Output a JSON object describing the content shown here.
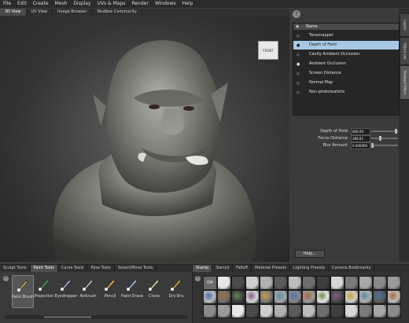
{
  "menu": [
    "File",
    "Edit",
    "Create",
    "Mesh",
    "Display",
    "UVs & Maps",
    "Render",
    "Windows",
    "Help"
  ],
  "view_tabs": [
    {
      "label": "3D View",
      "active": true
    },
    {
      "label": "UV View",
      "active": false
    },
    {
      "label": "Image Browser",
      "active": false
    },
    {
      "label": "Mudbox Community",
      "active": false
    }
  ],
  "viewcube": {
    "label": "FRONT"
  },
  "right_panel": {
    "help_icon": "?",
    "side_tabs": [
      "Layers",
      "Object List",
      "Viewport Filters"
    ],
    "filters_header": {
      "name_label": "Name"
    },
    "filters": [
      {
        "label": "Tonemapper",
        "selected": false,
        "enabled": false
      },
      {
        "label": "Depth of Field",
        "selected": true,
        "enabled": true
      },
      {
        "label": "Cavity Ambient Occlusion",
        "selected": false,
        "enabled": false
      },
      {
        "label": "Ambient Occlusion",
        "selected": false,
        "enabled": true
      },
      {
        "label": "Screen Distance",
        "selected": false,
        "enabled": false
      },
      {
        "label": "Normal Map",
        "selected": false,
        "enabled": false
      },
      {
        "label": "Non-photorealistic",
        "selected": false,
        "enabled": false
      }
    ],
    "properties": [
      {
        "label": "Depth of Field",
        "value": "600.00",
        "level": 0.95
      },
      {
        "label": "Focus Distance",
        "value": "368.81",
        "level": 0.3
      },
      {
        "label": "Blur Amount",
        "value": "0.000000",
        "level": 0.0
      }
    ],
    "help_button": "Help..."
  },
  "tool_tabs": [
    {
      "label": "Sculpt Tools",
      "active": false
    },
    {
      "label": "Paint Tools",
      "active": true
    },
    {
      "label": "Curve Tools",
      "active": false
    },
    {
      "label": "Pose Tools",
      "active": false
    },
    {
      "label": "Select/Move Tools",
      "active": false
    }
  ],
  "tools_help_icon": "?",
  "paint_tools": [
    {
      "label": "Paint Brush",
      "icon": "paint-brush-icon",
      "active": true,
      "color": "#c9a25a"
    },
    {
      "label": "Projection",
      "icon": "projection-icon",
      "active": false,
      "color": "#4f9a4f"
    },
    {
      "label": "Eyedropper",
      "icon": "eyedropper-icon",
      "active": false,
      "color": "#9aa8b8"
    },
    {
      "label": "Airbrush",
      "icon": "airbrush-icon",
      "active": false,
      "color": "#b0b0b0"
    },
    {
      "label": "Pencil",
      "icon": "pencil-icon",
      "active": false,
      "color": "#d8b040"
    },
    {
      "label": "Paint Erase",
      "icon": "eraser-icon",
      "active": false,
      "color": "#9fb8d8"
    },
    {
      "label": "Clone",
      "icon": "clone-icon",
      "active": false,
      "color": "#d0c890"
    },
    {
      "label": "Dry Bru",
      "icon": "dry-brush-icon",
      "active": false,
      "color": "#c8a040"
    }
  ],
  "stamp_tabs": [
    {
      "label": "Stamp",
      "active": true
    },
    {
      "label": "Stencil",
      "active": false
    },
    {
      "label": "Falloff",
      "active": false
    },
    {
      "label": "Material Presets",
      "active": false
    },
    {
      "label": "Lighting Presets",
      "active": false
    },
    {
      "label": "Camera Bookmarks",
      "active": false
    }
  ],
  "stamp_help_icon": "?",
  "stamp_off_label": "Off",
  "colors": {
    "selection": "#a8c9e6",
    "panel": "#3a3a3a",
    "menubar": "#2b2b2b"
  }
}
